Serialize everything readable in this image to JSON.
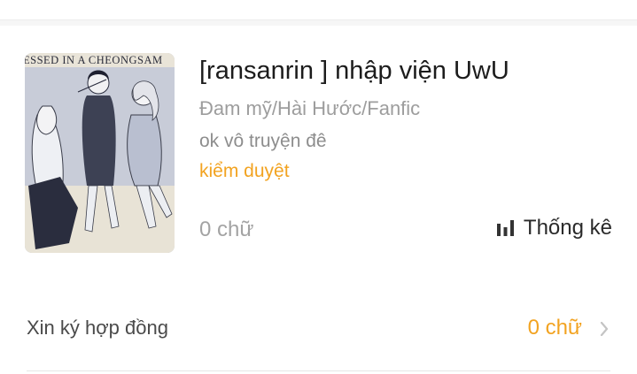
{
  "work": {
    "cover_caption": "ESSED IN A CHEONGSAM",
    "title": "[ransanrin ] nhập viện UwU",
    "genres": "Đam mỹ/Hài Hước/Fanfic",
    "description": "ok vô truyện đê",
    "status": "kiểm duyệt",
    "word_count": "0 chữ"
  },
  "stats": {
    "icon": "bar-chart-icon",
    "label": "Thống kê"
  },
  "contract": {
    "label": "Xin ký hợp đồng",
    "value": "0 chữ",
    "icon": "chevron-right-icon"
  },
  "colors": {
    "accent": "#f2a321",
    "title_text": "#1c1c1c",
    "muted_text": "#9d9d9d"
  }
}
